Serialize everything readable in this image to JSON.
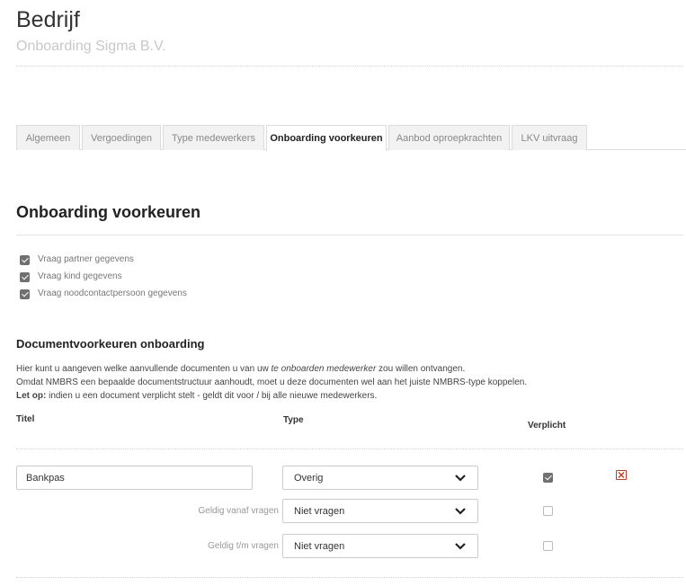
{
  "page": {
    "title": "Bedrijf",
    "subtitle": "Onboarding Sigma B.V."
  },
  "tabs": [
    {
      "label": "Algemeen",
      "active": false
    },
    {
      "label": "Vergoedingen",
      "active": false
    },
    {
      "label": "Type medewerkers",
      "active": false
    },
    {
      "label": "Onboarding voorkeuren",
      "active": true
    },
    {
      "label": "Aanbod oproepkrachten",
      "active": false
    },
    {
      "label": "LKV uitvraag",
      "active": false
    }
  ],
  "section": {
    "title": "Onboarding voorkeuren"
  },
  "options": [
    {
      "label": "Vraag partner gegevens",
      "checked": true
    },
    {
      "label": "Vraag kind gegevens",
      "checked": true
    },
    {
      "label": "Vraag noodcontactpersoon gegevens",
      "checked": true
    }
  ],
  "documents": {
    "title": "Documentvoorkeuren onboarding",
    "info_line1_prefix": "Hier kunt u aangeven welke aanvullende documenten u van uw ",
    "info_line1_emph": "te onboarden medewerker",
    "info_line1_suffix": " zou willen ontvangen.",
    "info_line2": "Omdat NMBRS een bepaalde documentstructuur aanhoudt, moet u deze documenten wel aan het juiste NMBRS-type koppelen.",
    "info_line3_bold": "Let op:",
    "info_line3_rest": " indien u een document verplicht stelt - geldt dit voor / bij alle nieuwe medewerkers.",
    "col_titel": "Titel",
    "col_type": "Type",
    "col_verplicht": "Verplicht",
    "row": {
      "titel_value": "Bankpas",
      "type_value": "Overig",
      "verplicht": true,
      "geldig_vanaf_label": "Geldig vanaf vragen",
      "geldig_vanaf_value": "Niet vragen",
      "geldig_vanaf_checked": false,
      "geldig_tm_label": "Geldig t/m vragen",
      "geldig_tm_value": "Niet vragen",
      "geldig_tm_checked": false
    }
  },
  "colors": {
    "accent_delete": "#c0392b",
    "subtitle": "#c8c8c8",
    "checkbox_checked": "#707070"
  }
}
